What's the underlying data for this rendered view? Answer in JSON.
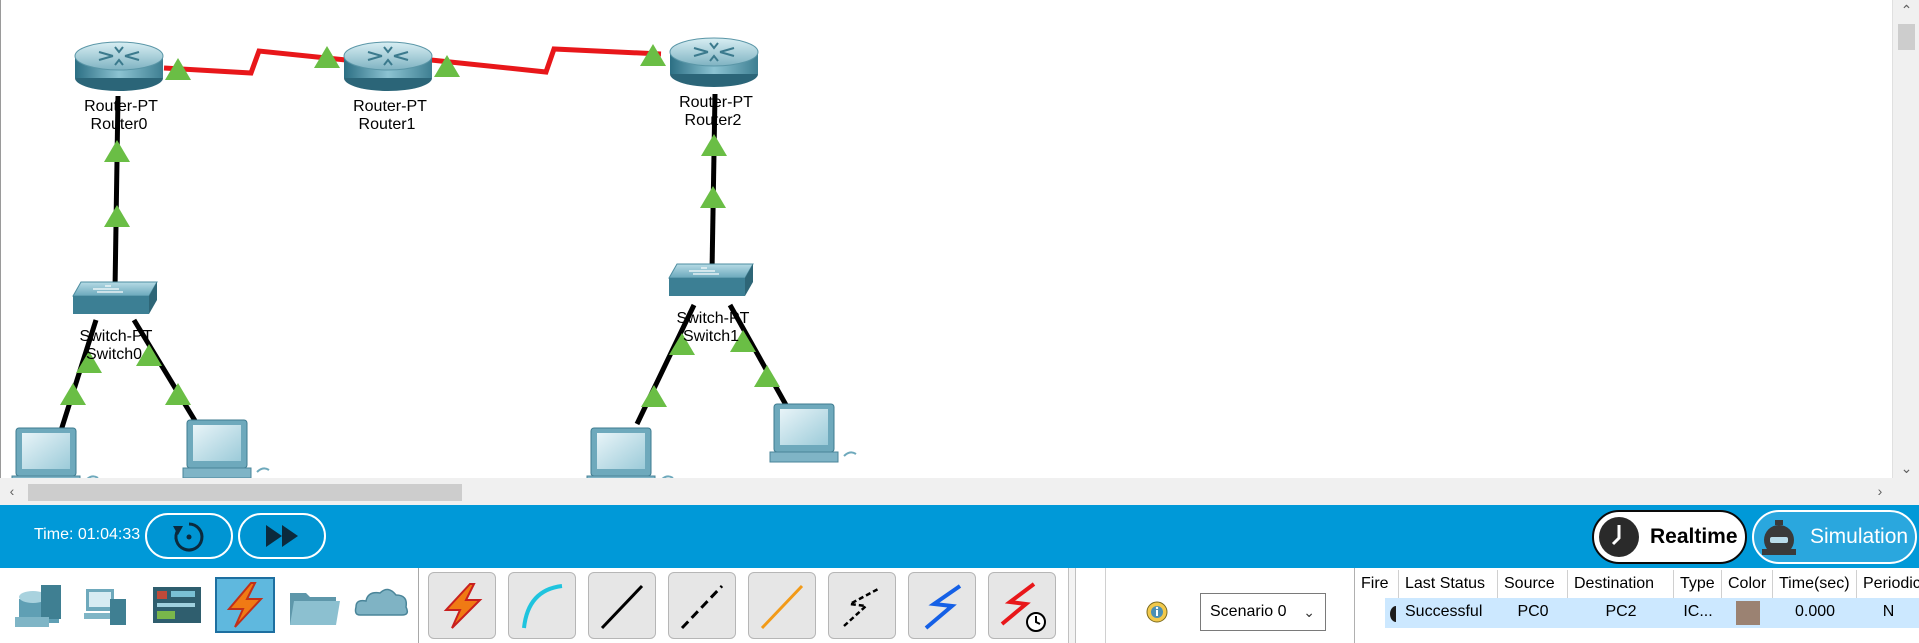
{
  "topology": {
    "routers": [
      {
        "model": "Router-PT",
        "name": "Router0"
      },
      {
        "model": "Router-PT",
        "name": "Router1"
      },
      {
        "model": "Router-PT",
        "name": "Router2"
      }
    ],
    "switches": [
      {
        "model": "Switch-PT",
        "name": "Switch0"
      },
      {
        "model": "Switch-PT",
        "name": "Switch1"
      }
    ],
    "colors": {
      "serial_link": "#e8171a",
      "ethernet_link": "#000000",
      "link_status": "#6abe45"
    }
  },
  "timebar": {
    "time_label": "Time: 01:04:33",
    "power_cycle_icon": "power-cycle-icon",
    "fast_forward_icon": "fast-forward-icon",
    "realtime_label": "Realtime",
    "simulation_label": "Simulation",
    "background": "#0099d8"
  },
  "device_categories": {
    "icons": [
      "network-devices-icon",
      "end-devices-icon",
      "components-icon",
      "connections-icon",
      "miscellaneous-icon",
      "multiuser-icon"
    ],
    "selected": "connections-icon"
  },
  "connections": {
    "icons": [
      "automatic-connection-icon",
      "console-cable-icon",
      "copper-straight-through-icon",
      "copper-cross-over-icon",
      "fiber-icon",
      "phone-cable-icon",
      "coaxial-icon",
      "serial-dce-icon"
    ]
  },
  "scenario": {
    "selected": "Scenario 0"
  },
  "pdu_list": {
    "columns": [
      "Fire",
      "Last Status",
      "Source",
      "Destination",
      "Type",
      "Color",
      "Time(sec)",
      "Periodic"
    ],
    "rows": [
      {
        "last_status": "Successful",
        "source": "PC0",
        "destination": "PC2",
        "type": "IC...",
        "color": "#9b8272",
        "time": "0.000",
        "periodic": "N"
      }
    ]
  }
}
